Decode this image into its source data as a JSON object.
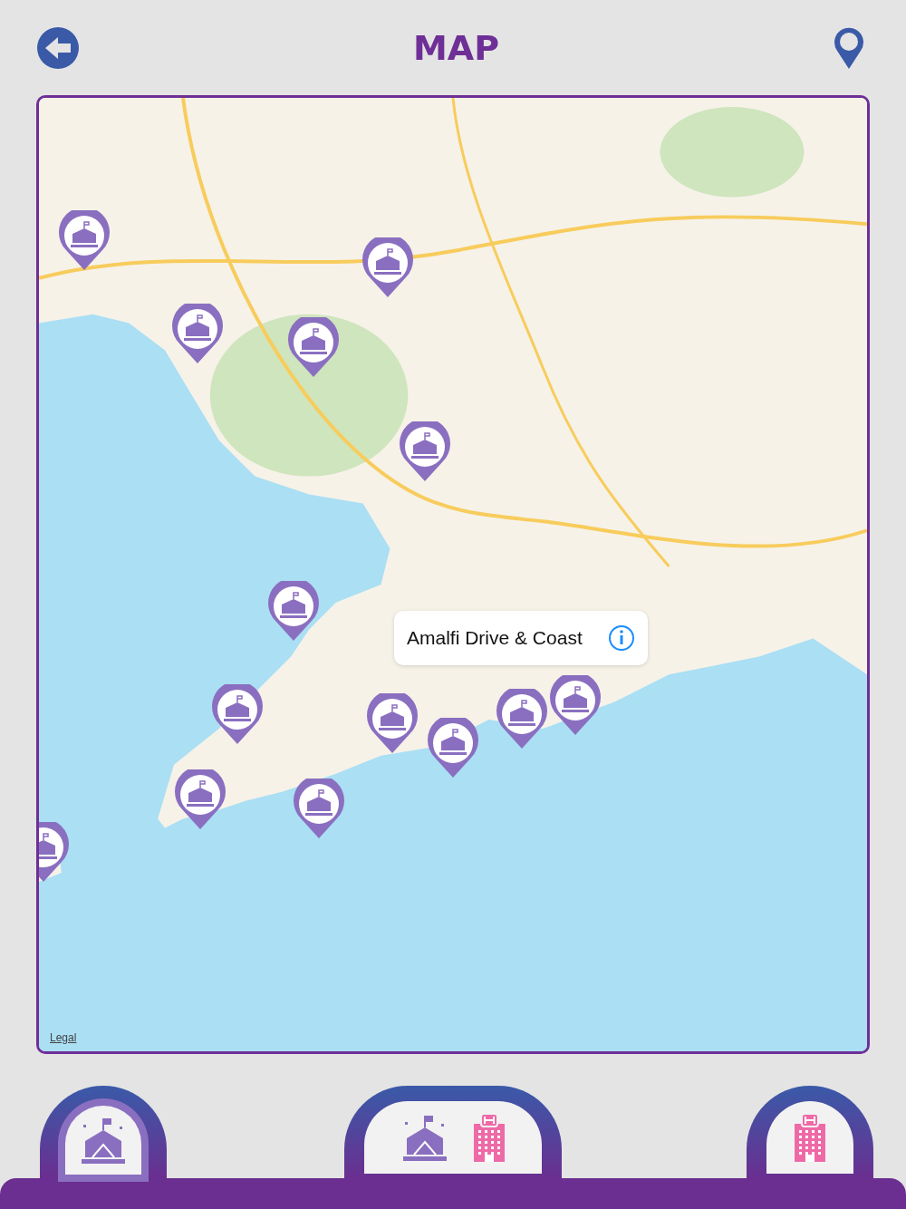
{
  "header": {
    "title": "MAP"
  },
  "map": {
    "callout": {
      "title": "Amalfi Drive & Coast"
    },
    "legal_link": "Legal"
  },
  "bottom_tabs": [
    {
      "kind": "events",
      "selected": true
    },
    {
      "kind": "both",
      "selected": false
    },
    {
      "kind": "hotels",
      "selected": false
    }
  ]
}
